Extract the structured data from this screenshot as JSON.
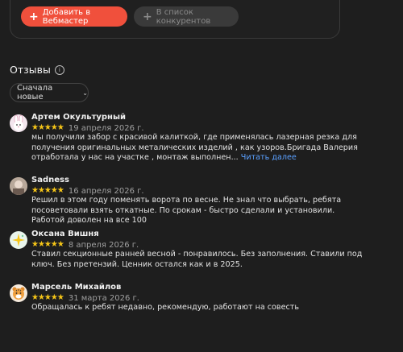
{
  "actions": {
    "add_webmaster_label": "Добавить в Вебмастер",
    "add_competitors_label": "В список конкурентов"
  },
  "reviews_section": {
    "title": "Отзывы",
    "sort_label": "Сначала новые"
  },
  "reviews": [
    {
      "author": "Артем Окультурный",
      "stars": "★★★★★",
      "date": "19 апреля 2026 г.",
      "text": "мы получили забор с красивой калиткой, где применялась  лазерная резка для получения оригинальных  металических изделий , как узоров.Бригада Валерия отработала у нас на участке , монтаж выполнен...",
      "more_label": "Читать далее",
      "avatar_icon": "bunny-face-icon"
    },
    {
      "author": "Sadness",
      "stars": "★★★★★",
      "date": "16 апреля 2026 г.",
      "text": "Решил в этом году поменять ворота по весне. Не знал что выбрать, ребята посоветовали взять откатные. По срокам - быстро сделали и установили. Работой доволен на все 100",
      "avatar_icon": "photo-avatar-icon"
    },
    {
      "author": "Оксана Вишня",
      "stars": "★★★★★",
      "date": "8 апреля 2026 г.",
      "text": "Ставил секционные ранней весной - понравилось. Без заполнения. Ставили под ключ. Без претензий. Ценник остался как и в 2025.",
      "avatar_icon": "sparkle-icon"
    },
    {
      "author": "Марсель Михайлов",
      "stars": "★★★★★",
      "date": "31 марта 2026 г.",
      "text": "Обращалась к ребят недавно, рекомендую,  работают на совесть",
      "avatar_icon": "tiger-face-icon"
    }
  ],
  "colors": {
    "background": "#1e1e1e",
    "primary_button": "#f0503c",
    "star": "#f5c518",
    "link": "#5aa0ff"
  }
}
